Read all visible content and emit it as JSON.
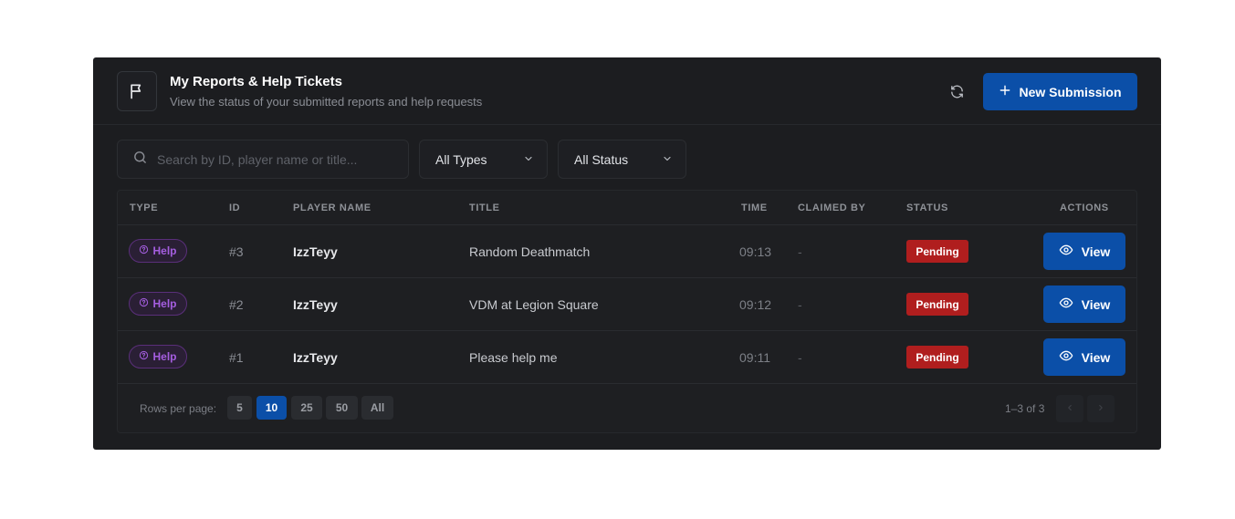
{
  "header": {
    "title": "My Reports & Help Tickets",
    "subtitle": "View the status of your submitted reports and help requests",
    "new_button_label": "New Submission"
  },
  "filters": {
    "search_placeholder": "Search by ID, player name or title...",
    "search_value": "",
    "type_selected": "All Types",
    "status_selected": "All Status"
  },
  "table": {
    "columns": [
      "TYPE",
      "ID",
      "PLAYER NAME",
      "TITLE",
      "TIME",
      "CLAIMED BY",
      "STATUS",
      "ACTIONS"
    ],
    "rows": [
      {
        "type": "Help",
        "id": "#3",
        "player": "IzzTeyy",
        "title": "Random Deathmatch",
        "time": "09:13",
        "claimed_by": "-",
        "status": "Pending",
        "action": "View"
      },
      {
        "type": "Help",
        "id": "#2",
        "player": "IzzTeyy",
        "title": "VDM at Legion Square",
        "time": "09:12",
        "claimed_by": "-",
        "status": "Pending",
        "action": "View"
      },
      {
        "type": "Help",
        "id": "#1",
        "player": "IzzTeyy",
        "title": "Please help me",
        "time": "09:11",
        "claimed_by": "-",
        "status": "Pending",
        "action": "View"
      }
    ]
  },
  "pagination": {
    "rows_per_page_label": "Rows per page:",
    "options": [
      "5",
      "10",
      "25",
      "50",
      "All"
    ],
    "selected": "10",
    "range_text": "1–3 of 3"
  },
  "colors": {
    "panel_bg": "#1c1d20",
    "accent": "#0b4fa8",
    "pending": "#b01e1e",
    "help_badge": "#a55ee0"
  },
  "icons": {
    "header": "flag-icon",
    "refresh": "refresh-icon",
    "new": "plus-icon",
    "search": "search-icon",
    "dropdown": "chevron-down-icon",
    "help": "question-circle-icon",
    "view": "eye-icon",
    "prev": "chevron-left-icon",
    "next": "chevron-right-icon"
  }
}
